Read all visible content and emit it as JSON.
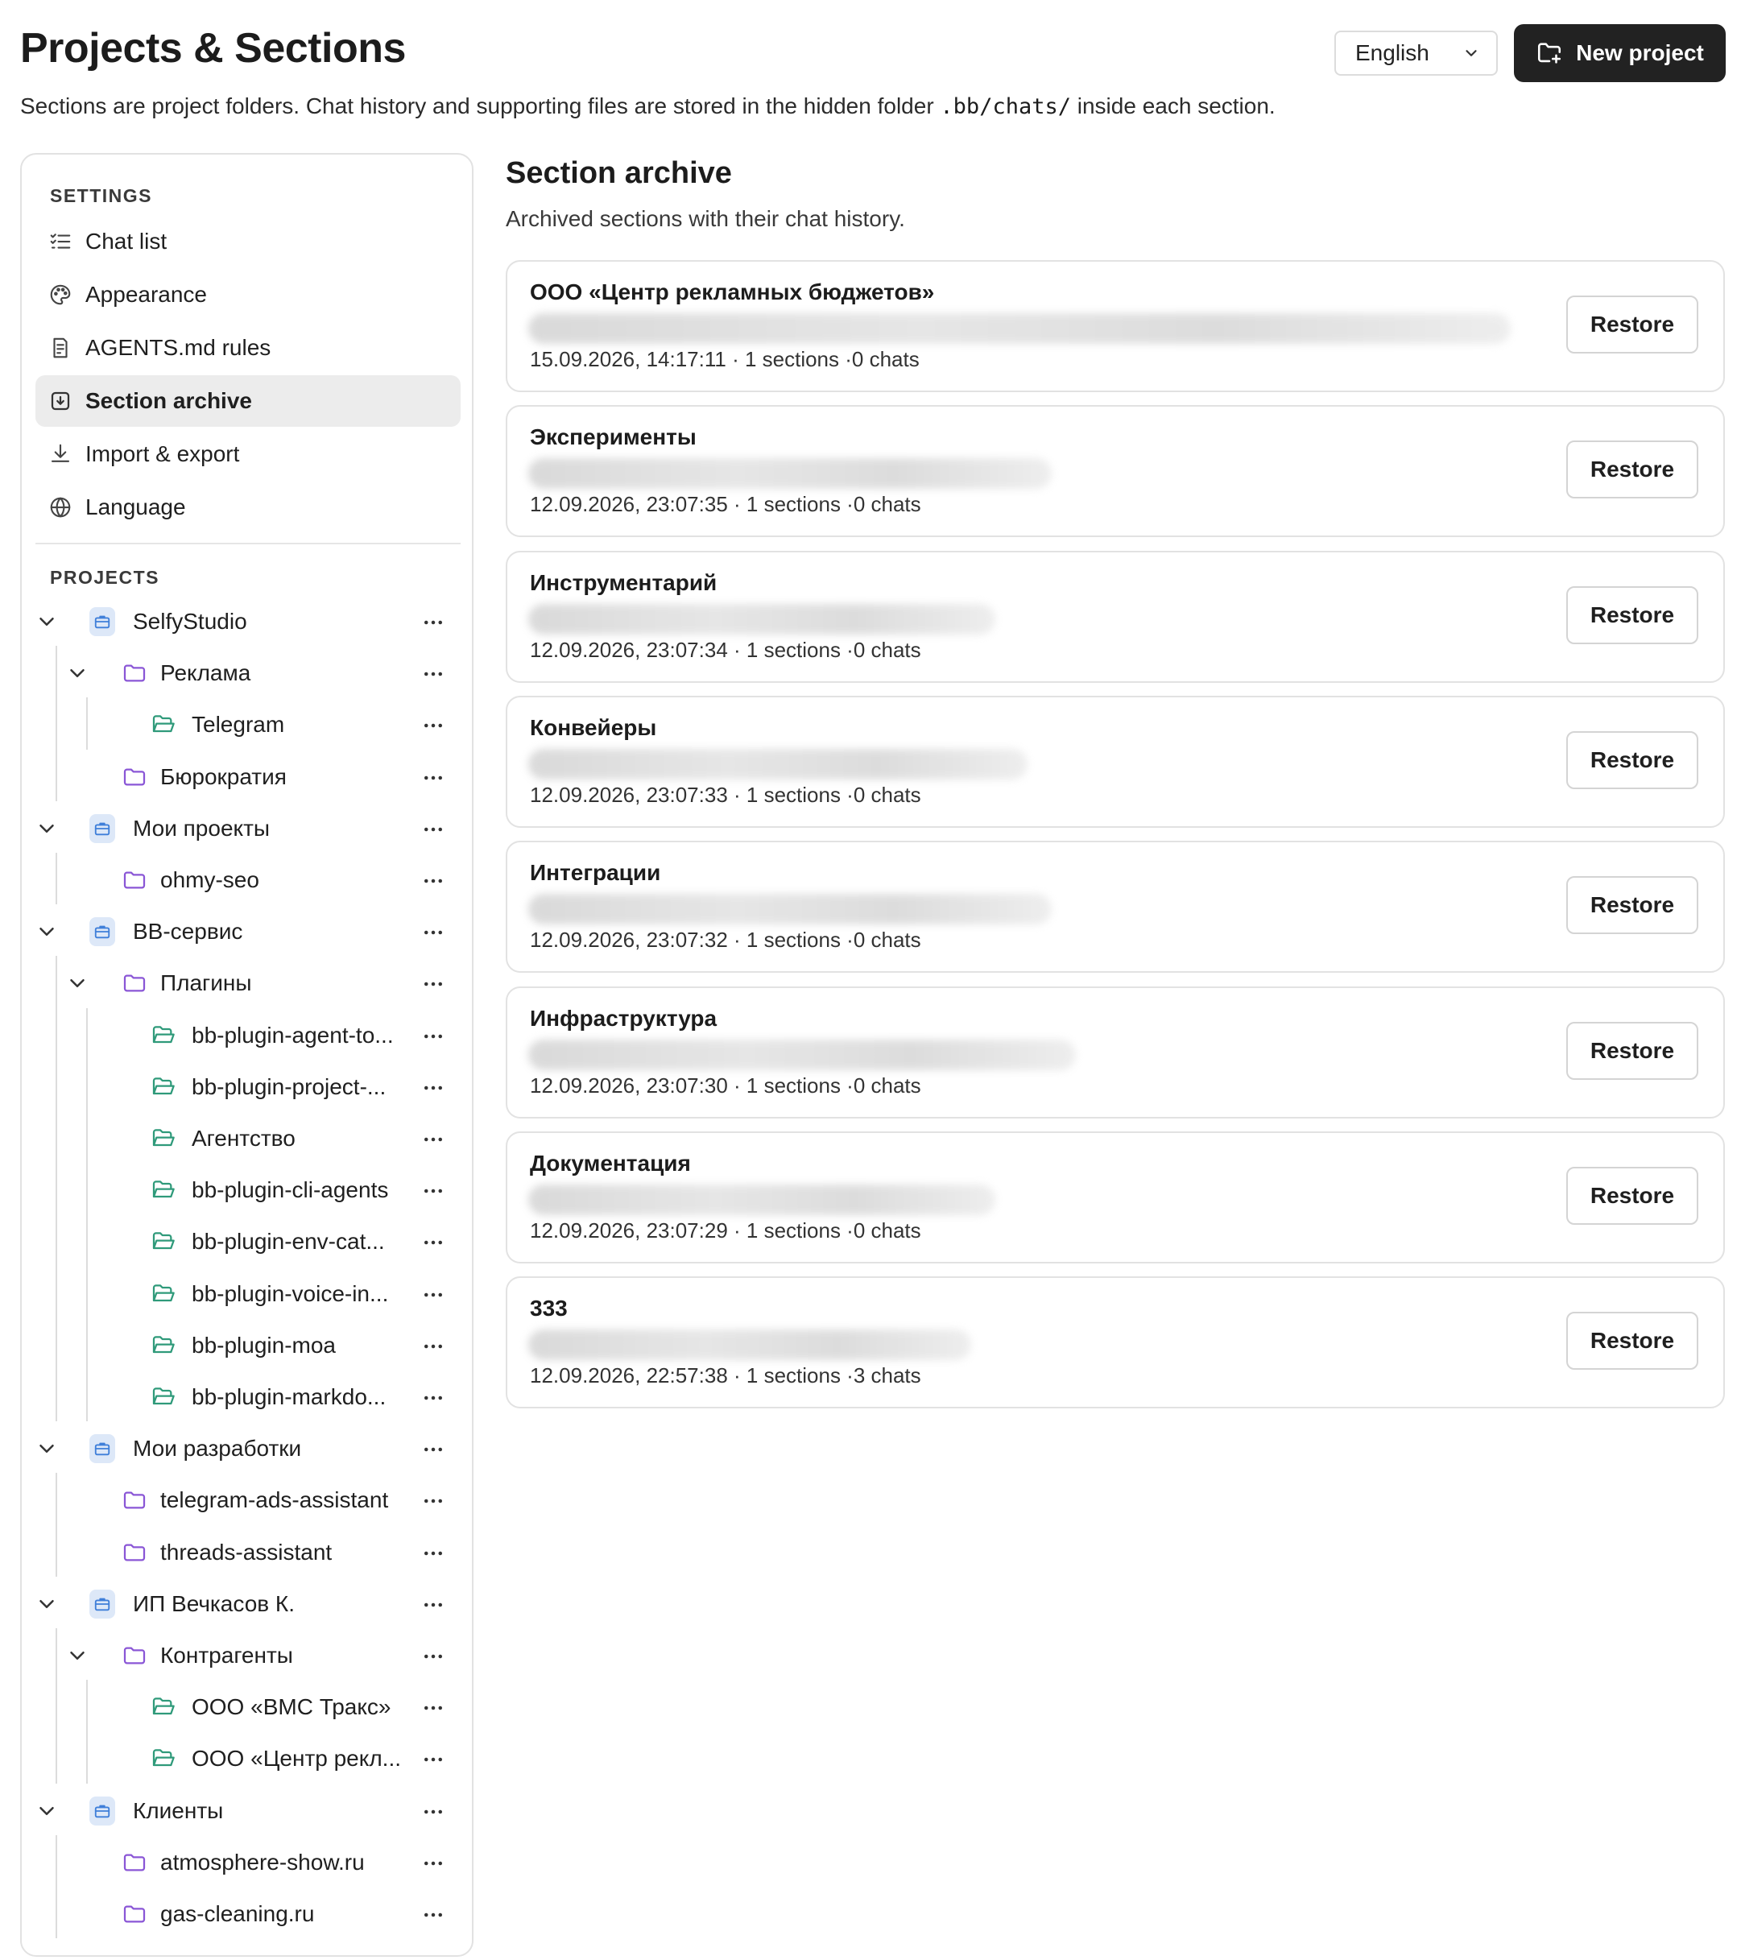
{
  "header": {
    "title": "Projects & Sections",
    "subtitle_before": "Sections are project folders. Chat history and supporting files are stored in the hidden folder ",
    "subtitle_code": ".bb/chats/",
    "subtitle_after": " inside each section.",
    "language_value": "English",
    "new_project_label": "New project"
  },
  "sidebar": {
    "settings_heading": "SETTINGS",
    "settings_items": [
      {
        "label": "Chat list",
        "icon": "list-check-icon"
      },
      {
        "label": "Appearance",
        "icon": "palette-icon"
      },
      {
        "label": "AGENTS.md rules",
        "icon": "document-icon"
      },
      {
        "label": "Section archive",
        "icon": "archive-icon",
        "active": true
      },
      {
        "label": "Import & export",
        "icon": "download-icon"
      },
      {
        "label": "Language",
        "icon": "globe-icon"
      }
    ],
    "projects_heading": "PROJECTS",
    "tree": [
      {
        "label": "SelfyStudio",
        "kind": "project",
        "depth": 0,
        "expanded": true
      },
      {
        "label": "Реклама",
        "kind": "folder",
        "depth": 1,
        "expanded": true
      },
      {
        "label": "Telegram",
        "kind": "section",
        "depth": 2
      },
      {
        "label": "Бюрократия",
        "kind": "folder",
        "depth": 1
      },
      {
        "label": "Мои проекты",
        "kind": "project",
        "depth": 0,
        "expanded": true
      },
      {
        "label": "ohmy-seo",
        "kind": "folder",
        "depth": 1
      },
      {
        "label": "BB-сервис",
        "kind": "project",
        "depth": 0,
        "expanded": true
      },
      {
        "label": "Плагины",
        "kind": "folder",
        "depth": 1,
        "expanded": true
      },
      {
        "label": "bb-plugin-agent-to...",
        "kind": "section",
        "depth": 2
      },
      {
        "label": "bb-plugin-project-...",
        "kind": "section",
        "depth": 2
      },
      {
        "label": "Агентство",
        "kind": "section",
        "depth": 2
      },
      {
        "label": "bb-plugin-cli-agents",
        "kind": "section",
        "depth": 2
      },
      {
        "label": "bb-plugin-env-cat...",
        "kind": "section",
        "depth": 2
      },
      {
        "label": "bb-plugin-voice-in...",
        "kind": "section",
        "depth": 2
      },
      {
        "label": "bb-plugin-moa",
        "kind": "section",
        "depth": 2
      },
      {
        "label": "bb-plugin-markdo...",
        "kind": "section",
        "depth": 2
      },
      {
        "label": "Мои разработки",
        "kind": "project",
        "depth": 0,
        "expanded": true
      },
      {
        "label": "telegram-ads-assistant",
        "kind": "folder",
        "depth": 1
      },
      {
        "label": "threads-assistant",
        "kind": "folder",
        "depth": 1
      },
      {
        "label": "ИП Вечкасов К.",
        "kind": "project",
        "depth": 0,
        "expanded": true
      },
      {
        "label": "Контрагенты",
        "kind": "folder",
        "depth": 1,
        "expanded": true
      },
      {
        "label": "ООО «ВМС Тракс»",
        "kind": "section",
        "depth": 2
      },
      {
        "label": "ООО «Центр рекл...",
        "kind": "section",
        "depth": 2
      },
      {
        "label": "Клиенты",
        "kind": "project",
        "depth": 0,
        "expanded": true
      },
      {
        "label": "atmosphere-show.ru",
        "kind": "folder",
        "depth": 1
      },
      {
        "label": "gas-cleaning.ru",
        "kind": "folder",
        "depth": 1
      }
    ]
  },
  "main": {
    "title": "Section archive",
    "subtitle": "Archived sections with their chat history.",
    "restore_label": "Restore",
    "archives": [
      {
        "title": "ООО «Центр рекламных бюджетов»",
        "meta": "15.09.2026, 14:17:11 · 1 sections ·0 chats"
      },
      {
        "title": "Эксперименты",
        "meta": "12.09.2026, 23:07:35 · 1 sections ·0 chats"
      },
      {
        "title": "Инструментарий",
        "meta": "12.09.2026, 23:07:34 · 1 sections ·0 chats"
      },
      {
        "title": "Конвейеры",
        "meta": "12.09.2026, 23:07:33 · 1 sections ·0 chats"
      },
      {
        "title": "Интеграции",
        "meta": "12.09.2026, 23:07:32 · 1 sections ·0 chats"
      },
      {
        "title": "Инфраструктура",
        "meta": "12.09.2026, 23:07:30 · 1 sections ·0 chats"
      },
      {
        "title": "Документация",
        "meta": "12.09.2026, 23:07:29 · 1 sections ·0 chats"
      },
      {
        "title": "333",
        "meta": "12.09.2026, 22:57:38 · 1 sections ·3 chats"
      }
    ]
  },
  "colors": {
    "accent_dark": "#222222",
    "folder_purple": "#8a56d6",
    "section_green": "#2f9a7a",
    "project_blue": "#3f7fd9"
  }
}
